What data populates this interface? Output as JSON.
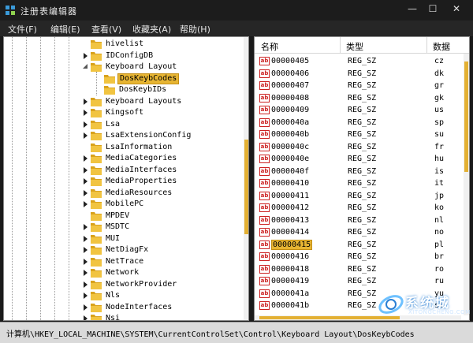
{
  "window": {
    "title": "注册表编辑器",
    "minimize": "—",
    "maximize": "☐",
    "close": "✕"
  },
  "menu": {
    "items": [
      {
        "label": "文件(F)"
      },
      {
        "label": "编辑(E)"
      },
      {
        "label": "查看(V)"
      },
      {
        "label": "收藏夹(A)"
      },
      {
        "label": "帮助(H)"
      }
    ]
  },
  "tree": {
    "nodes": [
      {
        "label": "hivelist",
        "expander": "none"
      },
      {
        "label": "IDConfigDB",
        "expander": "collapsed"
      },
      {
        "label": "Keyboard Layout",
        "expander": "expanded"
      },
      {
        "label": "DosKeybCodes",
        "expander": "none",
        "selected": true
      },
      {
        "label": "DosKeybIDs",
        "expander": "none"
      },
      {
        "label": "Keyboard Layouts",
        "expander": "collapsed"
      },
      {
        "label": "Kingsoft",
        "expander": "collapsed"
      },
      {
        "label": "Lsa",
        "expander": "collapsed"
      },
      {
        "label": "LsaExtensionConfig",
        "expander": "collapsed"
      },
      {
        "label": "LsaInformation",
        "expander": "none"
      },
      {
        "label": "MediaCategories",
        "expander": "collapsed"
      },
      {
        "label": "MediaInterfaces",
        "expander": "collapsed"
      },
      {
        "label": "MediaProperties",
        "expander": "collapsed"
      },
      {
        "label": "MediaResources",
        "expander": "collapsed"
      },
      {
        "label": "MobilePC",
        "expander": "collapsed"
      },
      {
        "label": "MPDEV",
        "expander": "none"
      },
      {
        "label": "MSDTC",
        "expander": "collapsed"
      },
      {
        "label": "MUI",
        "expander": "collapsed"
      },
      {
        "label": "NetDiagFx",
        "expander": "collapsed"
      },
      {
        "label": "NetTrace",
        "expander": "collapsed"
      },
      {
        "label": "Network",
        "expander": "collapsed"
      },
      {
        "label": "NetworkProvider",
        "expander": "collapsed"
      },
      {
        "label": "Nls",
        "expander": "collapsed"
      },
      {
        "label": "NodeInterfaces",
        "expander": "collapsed"
      },
      {
        "label": "Nsi",
        "expander": "collapsed"
      }
    ]
  },
  "list": {
    "columns": {
      "name": "名称",
      "type": "类型",
      "data": "数据"
    },
    "icon_text": "ab",
    "rows": [
      {
        "name": "00000405",
        "type": "REG_SZ",
        "data": "cz"
      },
      {
        "name": "00000406",
        "type": "REG_SZ",
        "data": "dk"
      },
      {
        "name": "00000407",
        "type": "REG_SZ",
        "data": "gr"
      },
      {
        "name": "00000408",
        "type": "REG_SZ",
        "data": "gk"
      },
      {
        "name": "00000409",
        "type": "REG_SZ",
        "data": "us"
      },
      {
        "name": "0000040a",
        "type": "REG_SZ",
        "data": "sp"
      },
      {
        "name": "0000040b",
        "type": "REG_SZ",
        "data": "su"
      },
      {
        "name": "0000040c",
        "type": "REG_SZ",
        "data": "fr"
      },
      {
        "name": "0000040e",
        "type": "REG_SZ",
        "data": "hu"
      },
      {
        "name": "0000040f",
        "type": "REG_SZ",
        "data": "is"
      },
      {
        "name": "00000410",
        "type": "REG_SZ",
        "data": "it"
      },
      {
        "name": "00000411",
        "type": "REG_SZ",
        "data": "jp"
      },
      {
        "name": "00000412",
        "type": "REG_SZ",
        "data": "ko"
      },
      {
        "name": "00000413",
        "type": "REG_SZ",
        "data": "nl"
      },
      {
        "name": "00000414",
        "type": "REG_SZ",
        "data": "no"
      },
      {
        "name": "00000415",
        "type": "REG_SZ",
        "data": "pl",
        "selected": true
      },
      {
        "name": "00000416",
        "type": "REG_SZ",
        "data": "br"
      },
      {
        "name": "00000418",
        "type": "REG_SZ",
        "data": "ro"
      },
      {
        "name": "00000419",
        "type": "REG_SZ",
        "data": "ru"
      },
      {
        "name": "0000041a",
        "type": "REG_SZ",
        "data": "yu"
      },
      {
        "name": "0000041b",
        "type": "REG_SZ",
        "data": "sl"
      }
    ]
  },
  "status": {
    "path": "计算机\\HKEY_LOCAL_MACHINE\\SYSTEM\\CurrentControlSet\\Control\\Keyboard Layout\\DosKeybCodes"
  },
  "watermark": {
    "title": "系统城",
    "url": "XITONGCHENG.COM"
  },
  "colors": {
    "accent": "#e7b533",
    "title_bar": "#1c1c1c",
    "status_bar": "#dadada"
  }
}
